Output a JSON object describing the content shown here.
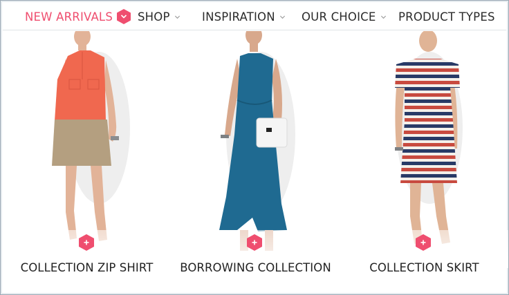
{
  "nav": {
    "items": [
      {
        "label": "NEW ARRIVALS",
        "active": true,
        "icon": "chevron-down-hex-badge"
      },
      {
        "label": "SHOP",
        "icon": "chevron-down-icon"
      },
      {
        "label": "INSPIRATION",
        "icon": "chevron-down-icon"
      },
      {
        "label": "OUR CHOICE",
        "icon": "chevron-down-icon"
      },
      {
        "label": "PRODUCT TYPES"
      }
    ]
  },
  "colors": {
    "accent": "#ef4e6f",
    "text": "#222222",
    "divider": "#dfe3e6"
  },
  "products": [
    {
      "title": "COLLECTION ZIP SHIRT",
      "dress": "coral top with khaki skirt",
      "add_icon": "plus-hex-icon"
    },
    {
      "title": "BORROWING COLLECTION",
      "dress": "teal maxi dress with white bag",
      "add_icon": "plus-hex-icon"
    },
    {
      "title": "COLLECTION SKIRT",
      "dress": "red white navy striped dress",
      "add_icon": "plus-hex-icon"
    }
  ]
}
